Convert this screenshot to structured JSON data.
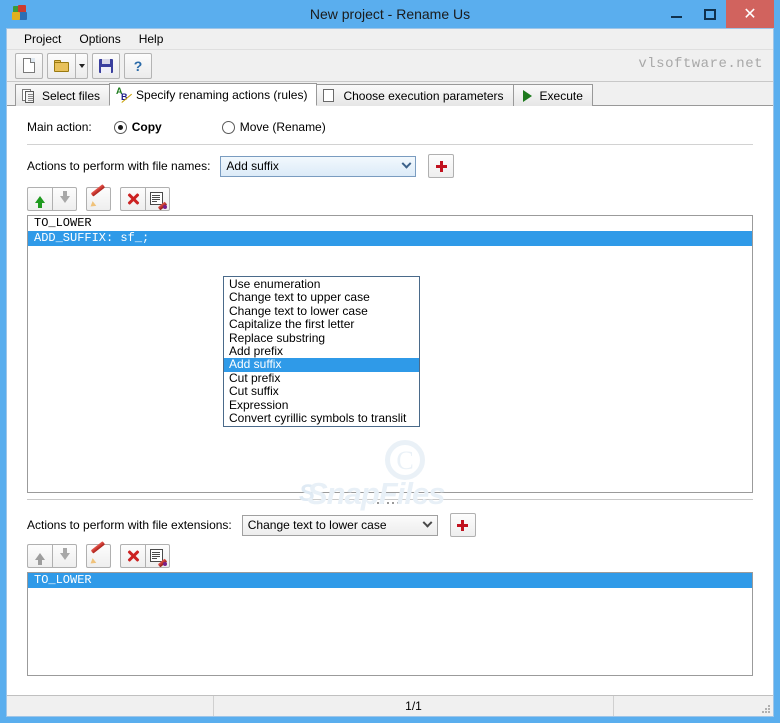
{
  "window": {
    "title": "New project - Rename Us",
    "app_icon": "app-logo-icon",
    "minimize_label": "",
    "maximize_label": "",
    "close_label": "✕"
  },
  "menubar": {
    "items": [
      {
        "label": "Project"
      },
      {
        "label": "Options"
      },
      {
        "label": "Help"
      }
    ]
  },
  "toolbar": {
    "buttons": [
      {
        "name": "new-project-button",
        "icon": "new-document-icon"
      },
      {
        "name": "open-project-button",
        "icon": "open-folder-icon"
      },
      {
        "name": "save-project-button",
        "icon": "floppy-save-icon"
      },
      {
        "name": "help-button",
        "icon": "question-mark-icon"
      }
    ],
    "brand": "vlsoftware.net"
  },
  "tabs": [
    {
      "label": "Select files",
      "icon": "documents-icon",
      "active": false
    },
    {
      "label": "Specify renaming actions (rules)",
      "icon": "ab-letters-icon",
      "active": true
    },
    {
      "label": "Choose execution parameters",
      "icon": "parameters-icon",
      "active": false
    },
    {
      "label": "Execute",
      "icon": "play-triangle-icon",
      "active": false
    }
  ],
  "main_action": {
    "label": "Main action:",
    "options": [
      {
        "label": "Copy",
        "selected": true
      },
      {
        "label": "Move (Rename)",
        "selected": false
      }
    ]
  },
  "file_names_section": {
    "label": "Actions to perform with file names:",
    "combo_value": "Add suffix",
    "add_button_label": "+",
    "toolbar_buttons": [
      {
        "name": "move-up-button",
        "icon": "arrow-up-icon",
        "enabled": true
      },
      {
        "name": "move-down-button",
        "icon": "arrow-down-icon",
        "enabled": false
      },
      {
        "name": "edit-rule-button",
        "icon": "pen-icon",
        "enabled": true
      },
      {
        "name": "delete-rule-button",
        "icon": "red-x-icon",
        "enabled": true
      },
      {
        "name": "edit-properties-button",
        "icon": "document-pen-icon",
        "enabled": true
      }
    ],
    "rules": [
      {
        "text": "TO_LOWER",
        "selected": false
      },
      {
        "text": "ADD_SUFFIX: sf_;",
        "selected": true
      }
    ]
  },
  "dropdown": {
    "open": true,
    "items": [
      {
        "label": "Use enumeration",
        "selected": false
      },
      {
        "label": "Change text to upper case",
        "selected": false
      },
      {
        "label": "Change text to lower case",
        "selected": false
      },
      {
        "label": "Capitalize the first letter",
        "selected": false
      },
      {
        "label": "Replace substring",
        "selected": false
      },
      {
        "label": "Add prefix",
        "selected": false
      },
      {
        "label": "Add suffix",
        "selected": true
      },
      {
        "label": "Cut prefix",
        "selected": false
      },
      {
        "label": "Cut suffix",
        "selected": false
      },
      {
        "label": "Expression",
        "selected": false
      },
      {
        "label": "Convert cyrillic symbols to translit",
        "selected": false
      }
    ]
  },
  "file_extensions_section": {
    "label": "Actions to perform with file extensions:",
    "combo_value": "Change text to lower case",
    "add_button_label": "+",
    "toolbar_buttons": [
      {
        "name": "move-up-button",
        "icon": "arrow-up-icon",
        "enabled": false
      },
      {
        "name": "move-down-button",
        "icon": "arrow-down-icon",
        "enabled": false
      },
      {
        "name": "edit-rule-button",
        "icon": "pen-icon",
        "enabled": true
      },
      {
        "name": "delete-rule-button",
        "icon": "red-x-icon",
        "enabled": true
      },
      {
        "name": "edit-properties-button",
        "icon": "document-pen-icon",
        "enabled": true
      }
    ],
    "rules": [
      {
        "text": "TO_LOWER",
        "selected": true
      }
    ]
  },
  "watermark": {
    "copyright_symbol": "C",
    "text": "SnapFiles"
  },
  "statusbar": {
    "cell1": "",
    "cell2": "1/1",
    "cell3": ""
  },
  "colors": {
    "window_frame": "#5aaeee",
    "selection": "#2f9ae8",
    "accent_red": "#c1121f",
    "close_button": "#d1635e"
  }
}
